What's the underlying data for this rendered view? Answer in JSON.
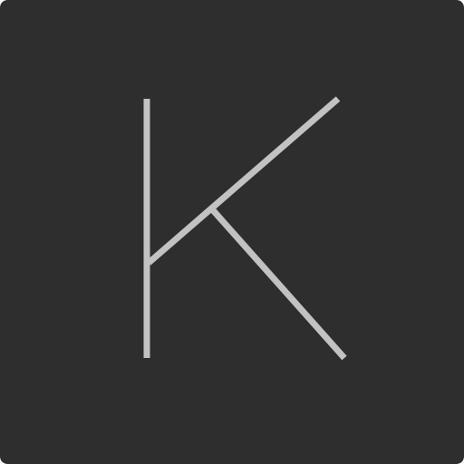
{
  "icon": {
    "name": "letter-k-logo",
    "glyph": "K",
    "background_color": "#2e2e2e",
    "stroke_color": "#c2c2c2"
  }
}
